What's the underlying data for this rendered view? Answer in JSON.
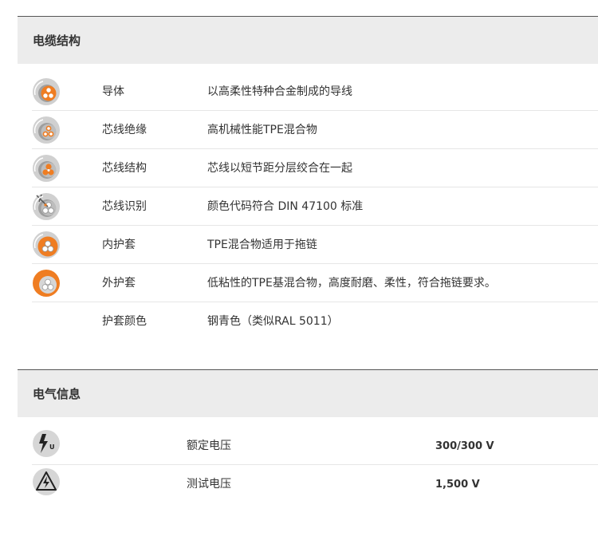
{
  "construction": {
    "title": "电缆结构",
    "rows": [
      {
        "icon": "conductor-cross-section-icon",
        "label": "导体",
        "value": "以高柔性特种合金制成的导线"
      },
      {
        "icon": "core-insulation-cross-section-icon",
        "label": "芯线绝缘",
        "value": "高机械性能TPE混合物"
      },
      {
        "icon": "core-structure-cross-section-icon",
        "label": "芯线结构",
        "value": "芯线以短节距分层绞合在一起"
      },
      {
        "icon": "core-identification-cross-section-icon",
        "label": "芯线识别",
        "value": "颜色代码符合 DIN 47100 标准"
      },
      {
        "icon": "inner-jacket-cross-section-icon",
        "label": "内护套",
        "value": "TPE混合物适用于拖链"
      },
      {
        "icon": "outer-jacket-cross-section-icon",
        "label": "外护套",
        "value": "低粘性的TPE基混合物，高度耐磨、柔性，符合拖链要求。"
      },
      {
        "icon": "",
        "label": "护套颜色",
        "value": "钢青色（类似RAL 5011）"
      }
    ]
  },
  "electrical": {
    "title": "电气信息",
    "rows": [
      {
        "icon": "rated-voltage-icon",
        "icon_text": "U",
        "label": "额定电压",
        "value": "300/300 V"
      },
      {
        "icon": "test-voltage-icon",
        "label": "测试电压",
        "value": "1,500 V"
      }
    ]
  },
  "colors": {
    "header_bg": "#ececec",
    "accent_orange": "#ef7d22",
    "icon_grey": "#9e9e9e"
  }
}
